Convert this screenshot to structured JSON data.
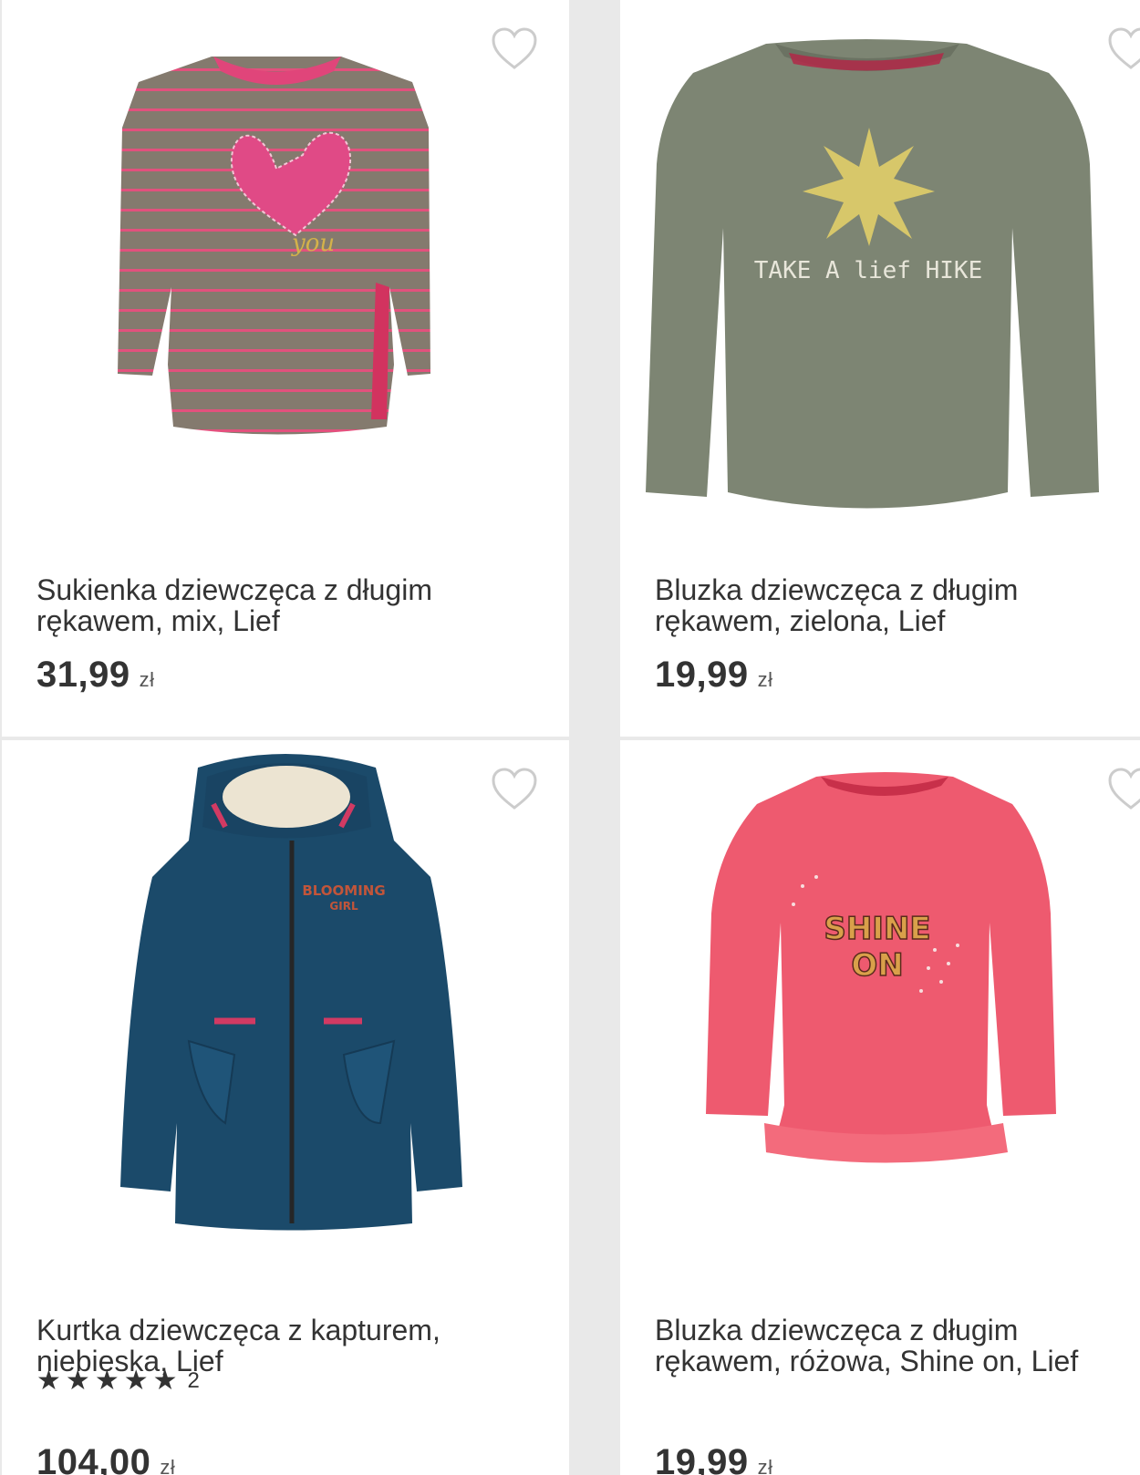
{
  "products": [
    {
      "title": "Sukienka dziewczęca z długim rękawem, mix, Lief",
      "price": "31,99",
      "currency": "zł",
      "wishlist_icon": "heart-outline-icon"
    },
    {
      "title": "Bluzka dziewczęca z długim rękawem, zielona, Lief",
      "price": "19,99",
      "currency": "zł",
      "wishlist_icon": "heart-outline-icon",
      "print_text": "TAKE A lief HIKE"
    },
    {
      "title": "Kurtka dziewczęca z kapturem, niebieska, Lief",
      "price": "104,00",
      "currency": "zł",
      "rating": {
        "stars": 5,
        "count": "2"
      },
      "wishlist_icon": "heart-outline-icon"
    },
    {
      "title": "Bluzka dziewczęca z długim rękawem, różowa, Shine on, Lief",
      "price": "19,99",
      "currency": "zł",
      "wishlist_icon": "heart-outline-icon",
      "print_text": [
        "SHINE",
        "ON"
      ]
    }
  ],
  "colors": {
    "background": "#e9e9e9",
    "card": "#ffffff",
    "text": "#333333",
    "heart_stroke": "#cccccc"
  }
}
